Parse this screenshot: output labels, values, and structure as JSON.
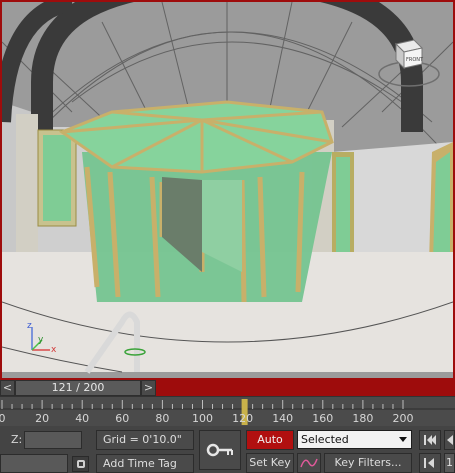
{
  "viewport": {
    "viewcube_label": "FRONT",
    "axis_x": "x",
    "axis_y": "y",
    "axis_z": "z",
    "active_border_color": "#9e0c0c"
  },
  "time_slider": {
    "prev_label": "<",
    "next_label": ">",
    "thumb_label": "121 / 200",
    "current_frame": 121,
    "total_frames": 200
  },
  "track_bar": {
    "tick_labels": [
      "0",
      "20",
      "40",
      "60",
      "80",
      "100",
      "120",
      "140",
      "160",
      "180",
      "200"
    ],
    "marker_frame": 121
  },
  "status": {
    "z_label": "Z:",
    "z_value": "",
    "grid_label": "Grid = 0'10.0\"",
    "add_time_tag": "Add Time Tag"
  },
  "animation": {
    "auto_key": "Auto Key",
    "selected_option": "Selected",
    "set_key": "Set Key",
    "key_filters": "Key Filters...",
    "frame_field": "1",
    "auto_key_color": "#b11010"
  },
  "icons": [
    "key-icon",
    "curve-icon",
    "goto-start-icon",
    "prev-key-icon",
    "time-tag-icon",
    "dropdown-arrow-icon",
    "viewcube-icon"
  ]
}
